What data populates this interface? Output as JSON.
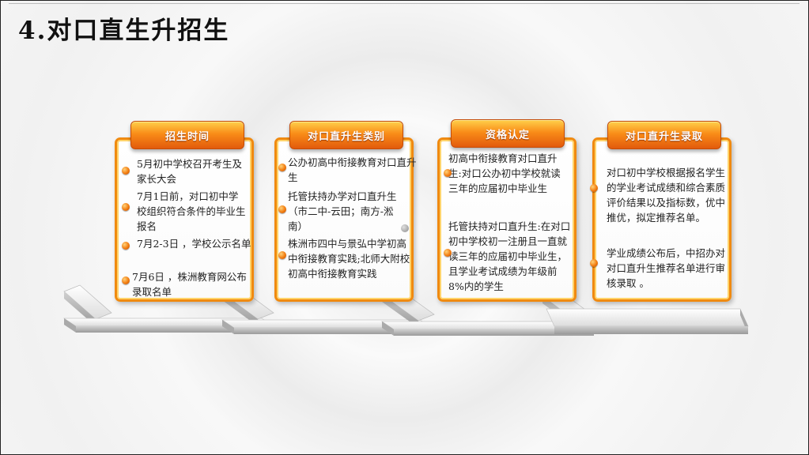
{
  "slide": {
    "title": "4.对口直生升招生"
  },
  "cards": [
    {
      "header": "招生时间",
      "items": [
        "5月初中学校召开考生及家长大会",
        "7月1日前，对口初中学校组织符合条件的毕业生报名",
        "7月2-3日 ，学校公示名单",
        "7月6日 ，株洲教育网公布录取名单"
      ]
    },
    {
      "header": "对口直升生类别",
      "items": [
        "公办初高中衔接教育对口直升生",
        "托管扶持办学对口直升生（市二中-云田；南方-淞南）",
        "株洲市四中与景弘中学初高中衔接教育实践;北师大附校初高中衔接教育实践"
      ]
    },
    {
      "header": "资格认定",
      "items": [
        "初高中衔接教育对口直升生:对口公办初中学校就读三年的应届初中毕业生",
        "托管扶持对口直升生:在对口初中学校初一注册且一直就读三年的应届初中毕业生，且学业考试成绩为年级前8%内的学生"
      ]
    },
    {
      "header": "对口直升生录取",
      "items": [
        "对口初中学校根据报名学生的学业考试成绩和综合素质评价结果以及指标数，优中推优，拟定推荐名单。",
        "学业成绩公布后，中招办对对口直升生推荐名单进行审核录取 。"
      ]
    }
  ],
  "colors": {
    "accent": "#f08a10",
    "header_dark": "#e25a0c",
    "header_light": "#ffd04a"
  }
}
